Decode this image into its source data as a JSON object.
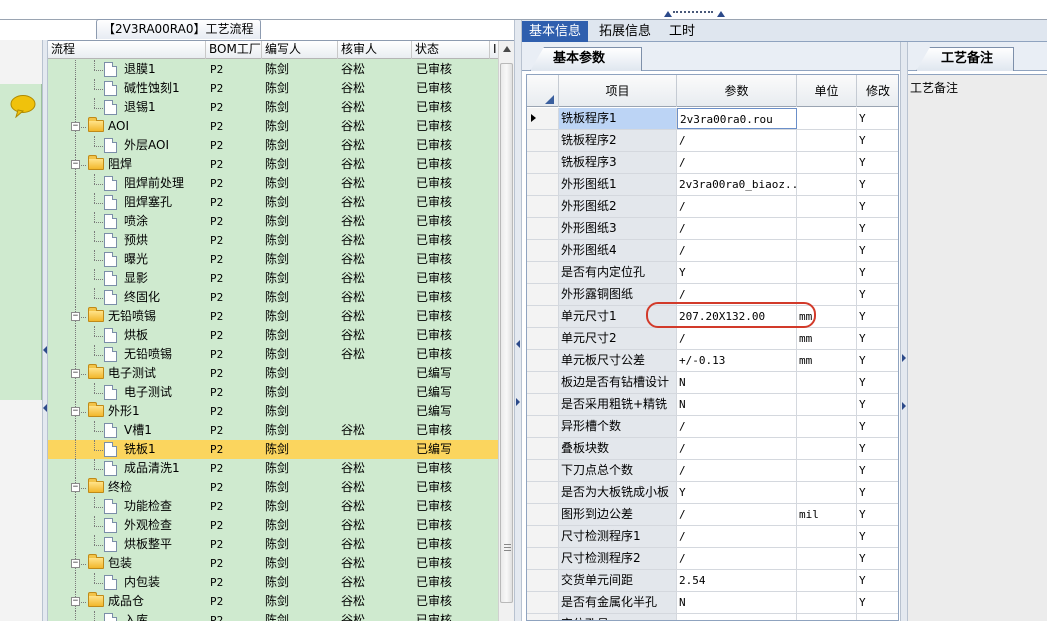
{
  "workflow_tab": "【2V3RA00RA0】工艺流程",
  "tree": {
    "headers": [
      "流程",
      "BOM工厂",
      "编写人",
      "核审人",
      "状态",
      "I"
    ],
    "rows": [
      {
        "name": "退膜1",
        "type": "doc",
        "level": 2,
        "bom": "P2",
        "writer": "陈剑",
        "reviewer": "谷松",
        "status": "已审核"
      },
      {
        "name": "碱性蚀刻1",
        "type": "doc",
        "level": 2,
        "bom": "P2",
        "writer": "陈剑",
        "reviewer": "谷松",
        "status": "已审核"
      },
      {
        "name": "退锡1",
        "type": "doc",
        "level": 2,
        "bom": "P2",
        "writer": "陈剑",
        "reviewer": "谷松",
        "status": "已审核"
      },
      {
        "name": "AOI",
        "type": "folder",
        "level": 1,
        "bom": "P2",
        "writer": "陈剑",
        "reviewer": "谷松",
        "status": "已审核"
      },
      {
        "name": "外层AOI",
        "type": "doc",
        "level": 2,
        "bom": "P2",
        "writer": "陈剑",
        "reviewer": "谷松",
        "status": "已审核"
      },
      {
        "name": "阻焊",
        "type": "folder",
        "level": 1,
        "bom": "P2",
        "writer": "陈剑",
        "reviewer": "谷松",
        "status": "已审核"
      },
      {
        "name": "阻焊前处理",
        "type": "doc",
        "level": 2,
        "bom": "P2",
        "writer": "陈剑",
        "reviewer": "谷松",
        "status": "已审核"
      },
      {
        "name": "阻焊塞孔",
        "type": "doc",
        "level": 2,
        "bom": "P2",
        "writer": "陈剑",
        "reviewer": "谷松",
        "status": "已审核"
      },
      {
        "name": "喷涂",
        "type": "doc",
        "level": 2,
        "bom": "P2",
        "writer": "陈剑",
        "reviewer": "谷松",
        "status": "已审核"
      },
      {
        "name": "预烘",
        "type": "doc",
        "level": 2,
        "bom": "P2",
        "writer": "陈剑",
        "reviewer": "谷松",
        "status": "已审核"
      },
      {
        "name": "曝光",
        "type": "doc",
        "level": 2,
        "bom": "P2",
        "writer": "陈剑",
        "reviewer": "谷松",
        "status": "已审核"
      },
      {
        "name": "显影",
        "type": "doc",
        "level": 2,
        "bom": "P2",
        "writer": "陈剑",
        "reviewer": "谷松",
        "status": "已审核"
      },
      {
        "name": "终固化",
        "type": "doc",
        "level": 2,
        "bom": "P2",
        "writer": "陈剑",
        "reviewer": "谷松",
        "status": "已审核"
      },
      {
        "name": "无铅喷锡",
        "type": "folder",
        "level": 1,
        "bom": "P2",
        "writer": "陈剑",
        "reviewer": "谷松",
        "status": "已审核"
      },
      {
        "name": "烘板",
        "type": "doc",
        "level": 2,
        "bom": "P2",
        "writer": "陈剑",
        "reviewer": "谷松",
        "status": "已审核"
      },
      {
        "name": "无铅喷锡",
        "type": "doc",
        "level": 2,
        "bom": "P2",
        "writer": "陈剑",
        "reviewer": "谷松",
        "status": "已审核"
      },
      {
        "name": "电子测试",
        "type": "folder",
        "level": 1,
        "bom": "P2",
        "writer": "陈剑",
        "reviewer": "",
        "status": "已编写"
      },
      {
        "name": "电子测试",
        "type": "doc",
        "level": 2,
        "bom": "P2",
        "writer": "陈剑",
        "reviewer": "",
        "status": "已编写"
      },
      {
        "name": "外形1",
        "type": "folder",
        "level": 1,
        "bom": "P2",
        "writer": "陈剑",
        "reviewer": "",
        "status": "已编写"
      },
      {
        "name": "V槽1",
        "type": "doc",
        "level": 2,
        "bom": "P2",
        "writer": "陈剑",
        "reviewer": "谷松",
        "status": "已审核"
      },
      {
        "name": "铣板1",
        "type": "doc",
        "level": 2,
        "bom": "P2",
        "writer": "陈剑",
        "reviewer": "",
        "status": "已编写",
        "selected": true
      },
      {
        "name": "成品清洗1",
        "type": "doc",
        "level": 2,
        "bom": "P2",
        "writer": "陈剑",
        "reviewer": "谷松",
        "status": "已审核"
      },
      {
        "name": "终检",
        "type": "folder",
        "level": 1,
        "bom": "P2",
        "writer": "陈剑",
        "reviewer": "谷松",
        "status": "已审核"
      },
      {
        "name": "功能检查",
        "type": "doc",
        "level": 2,
        "bom": "P2",
        "writer": "陈剑",
        "reviewer": "谷松",
        "status": "已审核"
      },
      {
        "name": "外观检查",
        "type": "doc",
        "level": 2,
        "bom": "P2",
        "writer": "陈剑",
        "reviewer": "谷松",
        "status": "已审核"
      },
      {
        "name": "烘板整平",
        "type": "doc",
        "level": 2,
        "bom": "P2",
        "writer": "陈剑",
        "reviewer": "谷松",
        "status": "已审核"
      },
      {
        "name": "包装",
        "type": "folder",
        "level": 1,
        "bom": "P2",
        "writer": "陈剑",
        "reviewer": "谷松",
        "status": "已审核"
      },
      {
        "name": "内包装",
        "type": "doc",
        "level": 2,
        "bom": "P2",
        "writer": "陈剑",
        "reviewer": "谷松",
        "status": "已审核"
      },
      {
        "name": "成品仓",
        "type": "folder",
        "level": 1,
        "bom": "P2",
        "writer": "陈剑",
        "reviewer": "谷松",
        "status": "已审核"
      },
      {
        "name": "入库",
        "type": "doc",
        "level": 2,
        "bom": "P2",
        "writer": "陈剑",
        "reviewer": "谷松",
        "status": "已审核"
      }
    ]
  },
  "right_tabs": [
    "基本信息",
    "拓展信息",
    "工时"
  ],
  "active_right_tab": 0,
  "params_tab": "基本参数",
  "grid": {
    "headers": [
      "项目",
      "参数",
      "单位",
      "修改"
    ],
    "rows": [
      {
        "item": "铣板程序1",
        "param": "2v3ra00ra0.rou",
        "unit": "",
        "mod": "Y",
        "current": true
      },
      {
        "item": "铣板程序2",
        "param": "/",
        "unit": "",
        "mod": "Y"
      },
      {
        "item": "铣板程序3",
        "param": "/",
        "unit": "",
        "mod": "Y"
      },
      {
        "item": "外形图纸1",
        "param": "2v3ra00ra0_biaoz...",
        "unit": "",
        "mod": "Y"
      },
      {
        "item": "外形图纸2",
        "param": "/",
        "unit": "",
        "mod": "Y"
      },
      {
        "item": "外形图纸3",
        "param": "/",
        "unit": "",
        "mod": "Y"
      },
      {
        "item": "外形图纸4",
        "param": "/",
        "unit": "",
        "mod": "Y"
      },
      {
        "item": "是否有内定位孔",
        "param": "Y",
        "unit": "",
        "mod": "Y"
      },
      {
        "item": "外形露铜图纸",
        "param": "/",
        "unit": "",
        "mod": "Y"
      },
      {
        "item": "单元尺寸1",
        "param": "207.20X132.00",
        "unit": "mm",
        "mod": "Y",
        "highlighted": true
      },
      {
        "item": "单元尺寸2",
        "param": "/",
        "unit": "mm",
        "mod": "Y"
      },
      {
        "item": "单元板尺寸公差",
        "param": "+/-0.13",
        "unit": "mm",
        "mod": "Y"
      },
      {
        "item": "板边是否有钻槽设计",
        "param": "N",
        "unit": "",
        "mod": "Y"
      },
      {
        "item": "是否采用粗铣+精铣",
        "param": "N",
        "unit": "",
        "mod": "Y"
      },
      {
        "item": "异形槽个数",
        "param": "/",
        "unit": "",
        "mod": "Y"
      },
      {
        "item": "叠板块数",
        "param": "/",
        "unit": "",
        "mod": "Y"
      },
      {
        "item": "下刀点总个数",
        "param": "/",
        "unit": "",
        "mod": "Y"
      },
      {
        "item": "是否为大板铣成小板",
        "param": "Y",
        "unit": "",
        "mod": "Y"
      },
      {
        "item": "图形到边公差",
        "param": "/",
        "unit": "mil",
        "mod": "Y"
      },
      {
        "item": "尺寸检测程序1",
        "param": "/",
        "unit": "",
        "mod": "Y"
      },
      {
        "item": "尺寸检测程序2",
        "param": "/",
        "unit": "",
        "mod": "Y"
      },
      {
        "item": "交货单元间距",
        "param": "2.54",
        "unit": "",
        "mod": "Y"
      },
      {
        "item": "是否有金属化半孔",
        "param": "N",
        "unit": "",
        "mod": "Y"
      },
      {
        "item": "定位孔号",
        "param": "/",
        "unit": "",
        "mod": "Y"
      }
    ]
  },
  "notes_tab": "工艺备注",
  "notes_label": "工艺备注",
  "colors": {
    "tree_bg": "#cfeacf",
    "selected_row": "#fbd55e",
    "active_tab": "#2f5fae",
    "highlight_oval": "#d23a2a"
  }
}
